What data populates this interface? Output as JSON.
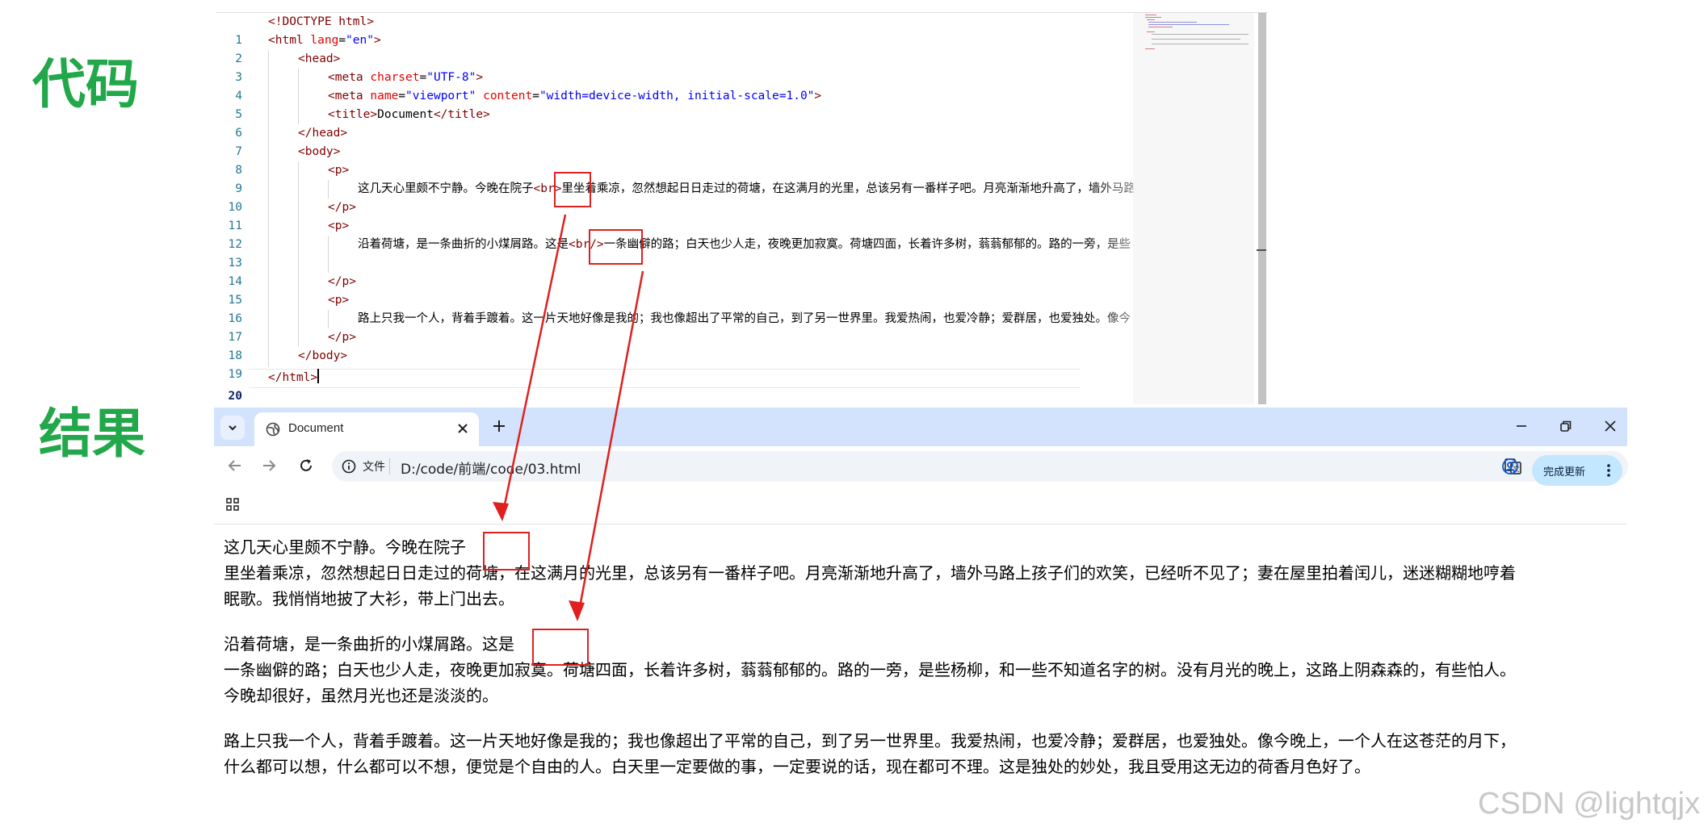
{
  "labels": {
    "code": "代码",
    "result": "结果"
  },
  "editor": {
    "line_numbers": [
      "1",
      "2",
      "3",
      "4",
      "5",
      "6",
      "7",
      "8",
      "9",
      "10",
      "11",
      "12",
      "13",
      "14",
      "15",
      "16",
      "17",
      "18",
      "19",
      "20"
    ],
    "lines": {
      "l1_doctype": "<!DOCTYPE html>",
      "l2_open": "<html ",
      "l2_attr": "lang",
      "l2_eq": "=",
      "l2_val": "\"en\"",
      "l2_close": ">",
      "l3": "<head>",
      "l4_open": "<meta ",
      "l4_attr": "charset",
      "l4_eq": "=",
      "l4_val": "\"UTF-8\"",
      "l4_close": ">",
      "l5_open": "<meta ",
      "l5_attr1": "name",
      "l5_eq1": "=",
      "l5_val1": "\"viewport\"",
      "l5_sp": " ",
      "l5_attr2": "content",
      "l5_eq2": "=",
      "l5_val2": "\"width=device-width, initial-scale=1.0\"",
      "l5_close": ">",
      "l6_open": "<title>",
      "l6_text": "Document",
      "l6_close": "</title>",
      "l7": "</head>",
      "l8": "<body>",
      "l9": "<p>",
      "l10_text1": "这几天心里颇不宁静。今晚在院子",
      "l10_tag": "<br>",
      "l10_text2": "里坐着乘凉，忽然想起日日走过的荷塘，在这满月的光里，总该另有一番样子吧。月亮渐渐地升高了，墙外马路",
      "l11": "</p>",
      "l12": "<p>",
      "l13_text1": "沿着荷塘，是一条曲折的小煤屑路。这是",
      "l13_tag": "<br/>",
      "l13_text2": "一条幽僻的路；白天也少人走，夜晚更加寂寞。荷塘四面，长着许多树，蓊蓊郁郁的。路的一旁，是些",
      "l15": "</p>",
      "l16": "<p>",
      "l17_text": "路上只我一个人，背着手踱着。这一片天地好像是我的；我也像超出了平常的自己，到了另一世界里。我爱热闹，也爱冷静；爱群居，也爱独处。像今",
      "l18": "</p>",
      "l19": "</body>",
      "l20": "</html>"
    }
  },
  "browser": {
    "tab_title": "Document",
    "omnibox_file_label": "文件",
    "url": "D:/code/前端/code/03.html",
    "update_button": "完成更新",
    "icons": [
      "tab-search-icon",
      "globe-icon",
      "close-icon",
      "new-tab-icon",
      "minimize-icon",
      "restore-icon",
      "window-close-icon",
      "back-icon",
      "forward-icon",
      "reload-icon",
      "info-icon",
      "translate-icon",
      "zoom-icon",
      "star-icon",
      "profile-icon",
      "more-icon",
      "apps-icon"
    ],
    "paragraphs": {
      "p1_l1": "这几天心里颇不宁静。今晚在院子",
      "p1_l2": "里坐着乘凉，忽然想起日日走过的荷塘，在这满月的光里，总该另有一番样子吧。月亮渐渐地升高了，墙外马路上孩子们的欢笑，已经听不见了；妻在屋里拍着闰儿，迷迷糊糊地哼着",
      "p1_l3": "眠歌。我悄悄地披了大衫，带上门出去。",
      "p2_l1": "沿着荷塘，是一条曲折的小煤屑路。这是",
      "p2_l2": "一条幽僻的路；白天也少人走，夜晚更加寂寞。荷塘四面，长着许多树，蓊蓊郁郁的。路的一旁，是些杨柳，和一些不知道名字的树。没有月光的晚上，这路上阴森森的，有些怕人。",
      "p2_l3": "今晚却很好，虽然月光也还是淡淡的。",
      "p3_l1": "路上只我一个人，背着手踱着。这一片天地好像是我的；我也像超出了平常的自己，到了另一世界里。我爱热闹，也爱冷静；爱群居，也爱独处。像今晚上，一个人在这苍茫的月下，",
      "p3_l2": "什么都可以想，什么都可以不想，便觉是个自由的人。白天里一定要做的事，一定要说的话，现在都可不理。这是独处的妙处，我且受用这无边的荷香月色好了。"
    }
  },
  "colors": {
    "label_green": "#22a84a",
    "annotation_red": "#e02020",
    "tabbar_bg": "#d3e3fd",
    "update_button_bg": "#c2e7ff"
  },
  "watermark": "CSDN @lightqjx"
}
